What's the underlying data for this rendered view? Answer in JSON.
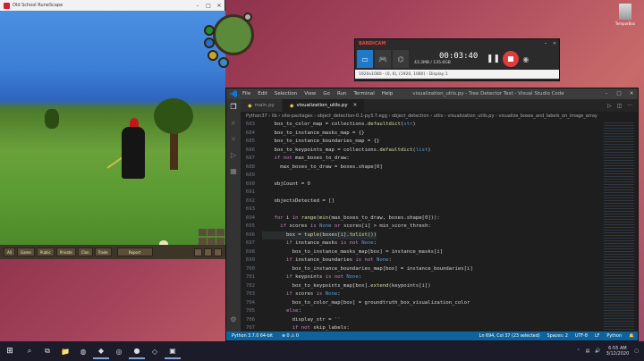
{
  "desktop": {
    "icon_label": "TemporBox"
  },
  "game": {
    "title": "Old School RuneScape",
    "buttons": [
      "All",
      "Game",
      "Public",
      "Private",
      "Clan",
      "Trade",
      "Report"
    ]
  },
  "bandicam": {
    "title": "BANDICAM",
    "timer": "00:03:40",
    "size": "43.3MB / 135.6GB",
    "footer": "1920x1080 - (0, 0), (1920, 1080) - Display 1"
  },
  "vscode": {
    "menu": [
      "File",
      "Edit",
      "Selection",
      "View",
      "Go",
      "Run",
      "Terminal",
      "Help"
    ],
    "window_title": "visualization_utils.py - Tree Detector Test - Visual Studio Code",
    "tabs": [
      {
        "label": "main.py",
        "active": false
      },
      {
        "label": "visualization_utils.py",
        "active": true
      }
    ],
    "breadcrumb": "Python37 › lib › site-packages › object_detection-0.1-py3.7.egg › object_detection › utils › visualization_utils.py › visualize_boxes_and_labels_on_image_array",
    "status": {
      "python": "Python 3.7.0 64-bit",
      "errors": "⊗ 0 ⚠ 0",
      "position": "Ln 694, Col 37 (23 selected)",
      "spaces": "Spaces: 2",
      "encoding": "UTF-8",
      "eol": "LF",
      "language": "Python"
    }
  },
  "taskbar": {
    "time": "6:55 AM",
    "date": "3/12/2020"
  }
}
